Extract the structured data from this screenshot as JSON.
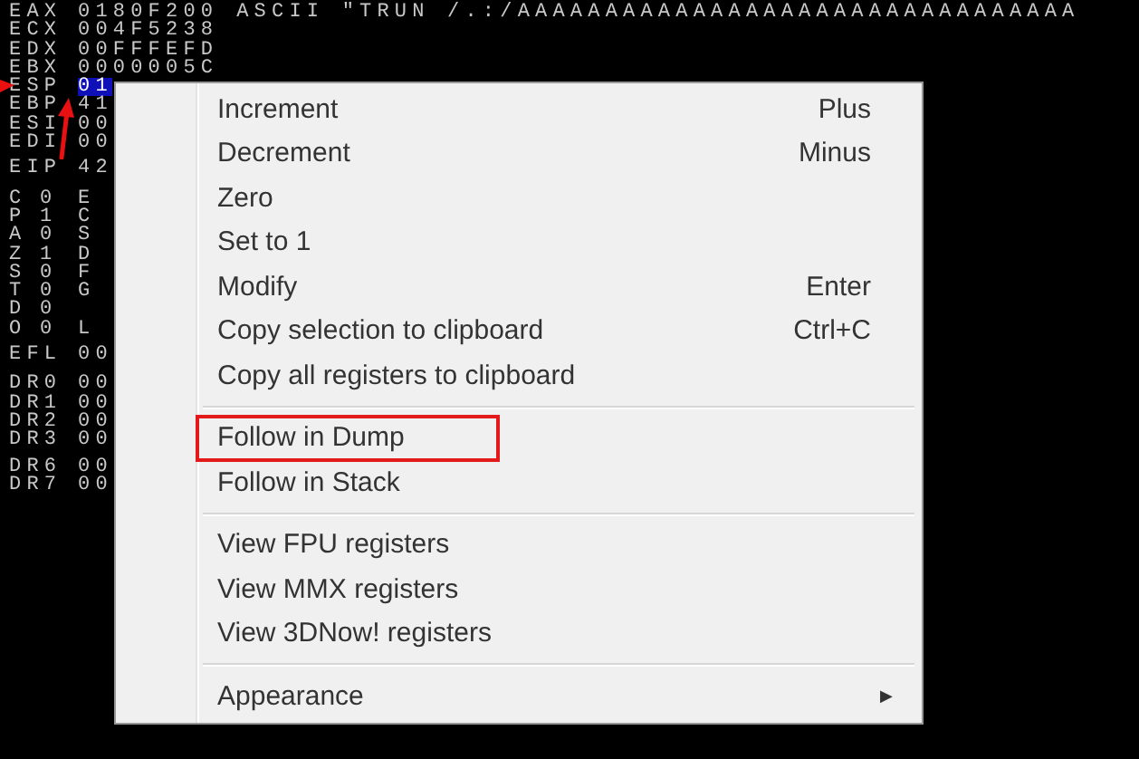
{
  "registers": [
    [
      {
        "name": "EAX",
        "value": "0180F200",
        "extra": "ASCII \"TRUN /.:/AAAAAAAAAAAAAAAAAAAAAAAAAAAAAAAA",
        "selected": false
      },
      {
        "name": "ECX",
        "value": "004F5238",
        "selected": false
      },
      {
        "name": "EDX",
        "value": "00FFFEFD",
        "selected": false
      },
      {
        "name": "EBX",
        "value": "0000005C",
        "selected": false
      },
      {
        "name": "ESP",
        "value": "01",
        "selected": true
      },
      {
        "name": "EBP",
        "value": "41",
        "selected": false
      },
      {
        "name": "ESI",
        "value": "00",
        "selected": false
      },
      {
        "name": "EDI",
        "value": "00",
        "selected": false
      }
    ],
    [
      {
        "name": "EIP",
        "value": "42",
        "selected": false
      }
    ],
    [
      {
        "name": "C",
        "value": "0",
        "extra": "E",
        "selected": false,
        "kind": "flag"
      },
      {
        "name": "P",
        "value": "1",
        "extra": "C",
        "selected": false,
        "kind": "flag"
      },
      {
        "name": "A",
        "value": "0",
        "extra": "S",
        "selected": false,
        "kind": "flag"
      },
      {
        "name": "Z",
        "value": "1",
        "extra": "D",
        "selected": false,
        "kind": "flag"
      },
      {
        "name": "S",
        "value": "0",
        "extra": "F",
        "selected": false,
        "kind": "flag"
      },
      {
        "name": "T",
        "value": "0",
        "extra": "G",
        "selected": false,
        "kind": "flag"
      },
      {
        "name": "D",
        "value": "0",
        "selected": false,
        "kind": "flag"
      },
      {
        "name": "O",
        "value": "0",
        "extra": "L",
        "selected": false,
        "kind": "flag"
      }
    ],
    [
      {
        "name": "EFL",
        "value": "00",
        "selected": false
      }
    ],
    [
      {
        "name": "DR0",
        "value": "00",
        "selected": false
      },
      {
        "name": "DR1",
        "value": "00",
        "selected": false
      },
      {
        "name": "DR2",
        "value": "00",
        "selected": false
      },
      {
        "name": "DR3",
        "value": "00",
        "selected": false
      }
    ],
    [
      {
        "name": "DR6",
        "value": "00",
        "selected": false
      },
      {
        "name": "DR7",
        "value": "00",
        "selected": false
      }
    ]
  ],
  "context_menu": [
    {
      "kind": "item",
      "label": "Increment",
      "shortcut": "Plus",
      "highlighted": false
    },
    {
      "kind": "item",
      "label": "Decrement",
      "shortcut": "Minus",
      "highlighted": false
    },
    {
      "kind": "item",
      "label": "Zero",
      "highlighted": false
    },
    {
      "kind": "item",
      "label": "Set to 1",
      "highlighted": false
    },
    {
      "kind": "item",
      "label": "Modify",
      "shortcut": "Enter",
      "highlighted": false
    },
    {
      "kind": "item",
      "label": "Copy selection to clipboard",
      "shortcut": "Ctrl+C",
      "highlighted": false
    },
    {
      "kind": "item",
      "label": "Copy all registers to clipboard",
      "highlighted": false
    },
    {
      "kind": "separator"
    },
    {
      "kind": "item",
      "label": "Follow in Dump",
      "highlighted": true
    },
    {
      "kind": "item",
      "label": "Follow in Stack",
      "highlighted": false
    },
    {
      "kind": "separator"
    },
    {
      "kind": "item",
      "label": "View FPU registers",
      "highlighted": false
    },
    {
      "kind": "item",
      "label": "View MMX registers",
      "highlighted": false
    },
    {
      "kind": "item",
      "label": "View 3DNow! registers",
      "highlighted": false
    },
    {
      "kind": "separator"
    },
    {
      "kind": "submenu",
      "label": "Appearance",
      "arrow": "▶",
      "highlighted": false
    }
  ]
}
